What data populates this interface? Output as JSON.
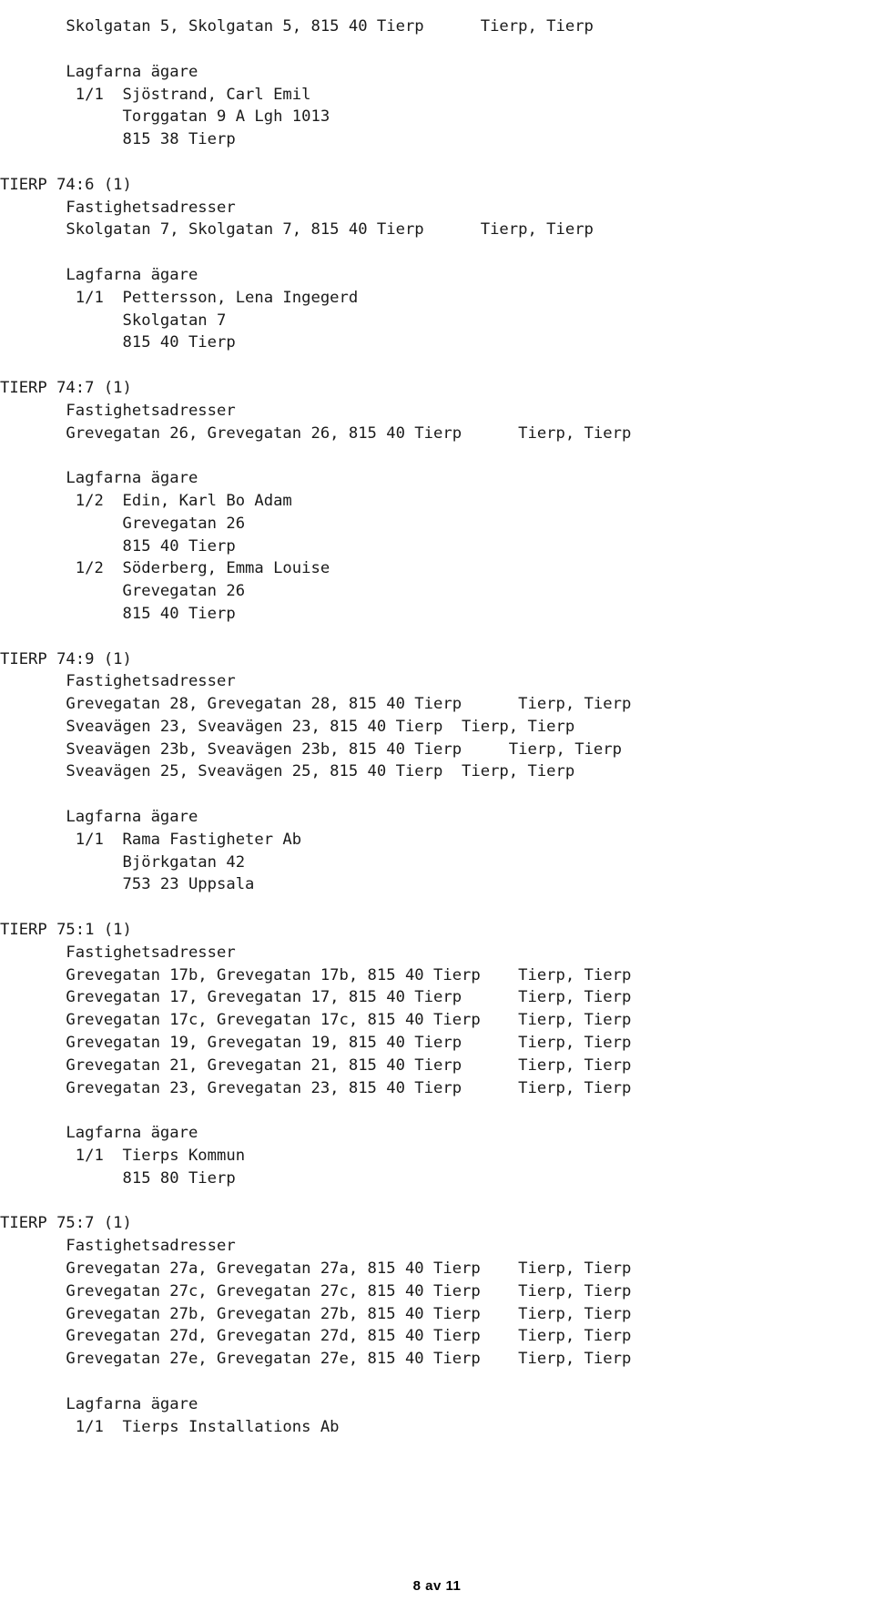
{
  "document": {
    "kind": "property-register-extract",
    "language": "sv",
    "section_labels": {
      "addresses": "Fastighetsadresser",
      "owners": "Lagfarna ägare"
    }
  },
  "footer": {
    "page_label": "8 av 11",
    "current_page": 8,
    "total_pages": 11
  },
  "continued_entry": {
    "address_rows": [
      {
        "street": "Skolgatan 5",
        "address": "Skolgatan 5, Skolgatan 5, 815 40 Tierp",
        "locality": "Tierp, Tierp"
      }
    ],
    "owners_label": "Lagfarna ägare",
    "owners": [
      {
        "share": "1/1",
        "name": "Sjöstrand, Carl Emil",
        "street": "Torggatan 9 A Lgh 1013",
        "postal": "815 38 Tierp"
      }
    ]
  },
  "entries": [
    {
      "designation": "TIERP 74:6 (1)",
      "addresses_label": "Fastighetsadresser",
      "address_rows": [
        {
          "address": "Skolgatan 7, Skolgatan 7, 815 40 Tierp",
          "locality": "Tierp, Tierp"
        }
      ],
      "owners_label": "Lagfarna ägare",
      "owners": [
        {
          "share": "1/1",
          "name": "Pettersson, Lena Ingegerd",
          "street": "Skolgatan 7",
          "postal": "815 40 Tierp"
        }
      ]
    },
    {
      "designation": "TIERP 74:7 (1)",
      "addresses_label": "Fastighetsadresser",
      "address_rows": [
        {
          "address": "Grevegatan 26, Grevegatan 26, 815 40 Tierp",
          "locality": "Tierp, Tierp"
        }
      ],
      "owners_label": "Lagfarna ägare",
      "owners": [
        {
          "share": "1/2",
          "name": "Edin, Karl Bo Adam",
          "street": "Grevegatan 26",
          "postal": "815 40 Tierp"
        },
        {
          "share": "1/2",
          "name": "Söderberg, Emma Louise",
          "street": "Grevegatan 26",
          "postal": "815 40 Tierp"
        }
      ]
    },
    {
      "designation": "TIERP 74:9 (1)",
      "addresses_label": "Fastighetsadresser",
      "address_rows": [
        {
          "address": "Grevegatan 28, Grevegatan 28, 815 40 Tierp",
          "locality": "Tierp, Tierp"
        },
        {
          "address": "Sveavägen 23, Sveavägen 23, 815 40 Tierp",
          "locality": "Tierp, Tierp"
        },
        {
          "address": "Sveavägen 23b, Sveavägen 23b, 815 40 Tierp",
          "locality": "Tierp, Tierp"
        },
        {
          "address": "Sveavägen 25, Sveavägen 25, 815 40 Tierp",
          "locality": "Tierp, Tierp"
        }
      ],
      "owners_label": "Lagfarna ägare",
      "owners": [
        {
          "share": "1/1",
          "name": "Rama Fastigheter Ab",
          "street": "Björkgatan 42",
          "postal": "753 23 Uppsala"
        }
      ]
    },
    {
      "designation": "TIERP 75:1 (1)",
      "addresses_label": "Fastighetsadresser",
      "address_rows": [
        {
          "address": "Grevegatan 17b, Grevegatan 17b, 815 40 Tierp",
          "locality": "Tierp, Tierp"
        },
        {
          "address": "Grevegatan 17, Grevegatan 17, 815 40 Tierp",
          "locality": "Tierp, Tierp"
        },
        {
          "address": "Grevegatan 17c, Grevegatan 17c, 815 40 Tierp",
          "locality": "Tierp, Tierp"
        },
        {
          "address": "Grevegatan 19, Grevegatan 19, 815 40 Tierp",
          "locality": "Tierp, Tierp"
        },
        {
          "address": "Grevegatan 21, Grevegatan 21, 815 40 Tierp",
          "locality": "Tierp, Tierp"
        },
        {
          "address": "Grevegatan 23, Grevegatan 23, 815 40 Tierp",
          "locality": "Tierp, Tierp"
        }
      ],
      "owners_label": "Lagfarna ägare",
      "owners": [
        {
          "share": "1/1",
          "name": "Tierps Kommun",
          "street": "",
          "postal": "815 80 Tierp"
        }
      ]
    },
    {
      "designation": "TIERP 75:7 (1)",
      "addresses_label": "Fastighetsadresser",
      "address_rows": [
        {
          "address": "Grevegatan 27a, Grevegatan 27a, 815 40 Tierp",
          "locality": "Tierp, Tierp"
        },
        {
          "address": "Grevegatan 27c, Grevegatan 27c, 815 40 Tierp",
          "locality": "Tierp, Tierp"
        },
        {
          "address": "Grevegatan 27b, Grevegatan 27b, 815 40 Tierp",
          "locality": "Tierp, Tierp"
        },
        {
          "address": "Grevegatan 27d, Grevegatan 27d, 815 40 Tierp",
          "locality": "Tierp, Tierp"
        },
        {
          "address": "Grevegatan 27e, Grevegatan 27e, 815 40 Tierp",
          "locality": "Tierp, Tierp"
        }
      ],
      "owners_label": "Lagfarna ägare",
      "owners": [
        {
          "share": "1/1",
          "name": "Tierps Installations Ab",
          "street": "",
          "postal": ""
        }
      ]
    }
  ],
  "rendered_text": "       Skolgatan 5, Skolgatan 5, 815 40 Tierp      Tierp, Tierp\n\n       Lagfarna ägare\n        1/1  Sjöstrand, Carl Emil\n             Torggatan 9 A Lgh 1013\n             815 38 Tierp\n\nTIERP 74:6 (1)\n       Fastighetsadresser\n       Skolgatan 7, Skolgatan 7, 815 40 Tierp      Tierp, Tierp\n\n       Lagfarna ägare\n        1/1  Pettersson, Lena Ingegerd\n             Skolgatan 7\n             815 40 Tierp\n\nTIERP 74:7 (1)\n       Fastighetsadresser\n       Grevegatan 26, Grevegatan 26, 815 40 Tierp      Tierp, Tierp\n\n       Lagfarna ägare\n        1/2  Edin, Karl Bo Adam\n             Grevegatan 26\n             815 40 Tierp\n        1/2  Söderberg, Emma Louise\n             Grevegatan 26\n             815 40 Tierp\n\nTIERP 74:9 (1)\n       Fastighetsadresser\n       Grevegatan 28, Grevegatan 28, 815 40 Tierp      Tierp, Tierp\n       Sveavägen 23, Sveavägen 23, 815 40 Tierp  Tierp, Tierp\n       Sveavägen 23b, Sveavägen 23b, 815 40 Tierp     Tierp, Tierp\n       Sveavägen 25, Sveavägen 25, 815 40 Tierp  Tierp, Tierp\n\n       Lagfarna ägare\n        1/1  Rama Fastigheter Ab\n             Björkgatan 42\n             753 23 Uppsala\n\nTIERP 75:1 (1)\n       Fastighetsadresser\n       Grevegatan 17b, Grevegatan 17b, 815 40 Tierp    Tierp, Tierp\n       Grevegatan 17, Grevegatan 17, 815 40 Tierp      Tierp, Tierp\n       Grevegatan 17c, Grevegatan 17c, 815 40 Tierp    Tierp, Tierp\n       Grevegatan 19, Grevegatan 19, 815 40 Tierp      Tierp, Tierp\n       Grevegatan 21, Grevegatan 21, 815 40 Tierp      Tierp, Tierp\n       Grevegatan 23, Grevegatan 23, 815 40 Tierp      Tierp, Tierp\n\n       Lagfarna ägare\n        1/1  Tierps Kommun\n             815 80 Tierp\n\nTIERP 75:7 (1)\n       Fastighetsadresser\n       Grevegatan 27a, Grevegatan 27a, 815 40 Tierp    Tierp, Tierp\n       Grevegatan 27c, Grevegatan 27c, 815 40 Tierp    Tierp, Tierp\n       Grevegatan 27b, Grevegatan 27b, 815 40 Tierp    Tierp, Tierp\n       Grevegatan 27d, Grevegatan 27d, 815 40 Tierp    Tierp, Tierp\n       Grevegatan 27e, Grevegatan 27e, 815 40 Tierp    Tierp, Tierp\n\n       Lagfarna ägare\n        1/1  Tierps Installations Ab"
}
